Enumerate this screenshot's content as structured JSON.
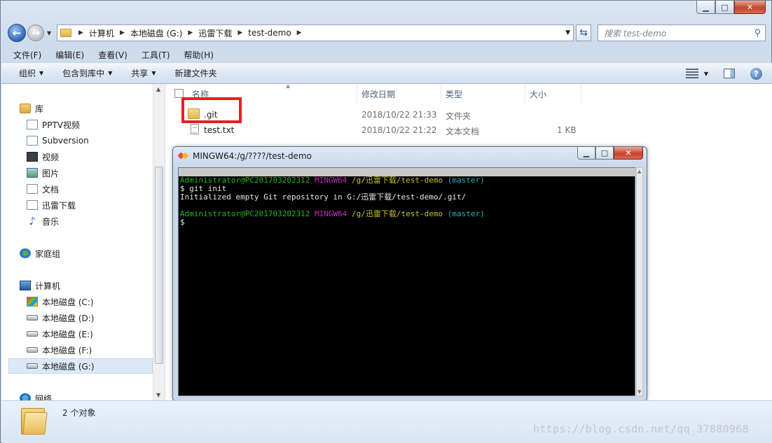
{
  "window": {
    "caption": {
      "minimize": "▁",
      "maximize": "□",
      "close": "✕"
    }
  },
  "address": {
    "breadcrumbs": [
      "计算机",
      "本地磁盘 (G:)",
      "迅雷下载",
      "test-demo"
    ],
    "search_placeholder": "搜索 test-demo"
  },
  "menubar": [
    "文件(F)",
    "编辑(E)",
    "查看(V)",
    "工具(T)",
    "帮助(H)"
  ],
  "commands": [
    "组织",
    "包含到库中",
    "共享",
    "新建文件夹"
  ],
  "navpane": {
    "libraries": "库",
    "library_items": [
      "PPTV视频",
      "Subversion",
      "视频",
      "图片",
      "文档",
      "迅雷下载",
      "音乐"
    ],
    "homegroup": "家庭组",
    "computer": "计算机",
    "drives": [
      "本地磁盘 (C:)",
      "本地磁盘 (D:)",
      "本地磁盘 (E:)",
      "本地磁盘 (F:)",
      "本地磁盘 (G:)"
    ],
    "selected_drive": "本地磁盘 (G:)",
    "network": "网络"
  },
  "columns": [
    "名称",
    "修改日期",
    "类型",
    "大小"
  ],
  "files": [
    {
      "name": ".git",
      "date": "2018/10/22 21:33",
      "type": "文件夹",
      "size": "",
      "icon": "folder-icon"
    },
    {
      "name": "test.txt",
      "date": "2018/10/22 21:22",
      "type": "文本文档",
      "size": "1 KB",
      "icon": "text-file-icon"
    }
  ],
  "status": {
    "count": "2 个对象"
  },
  "terminal": {
    "title": "MINGW64:/g/????/test-demo",
    "lines": [
      {
        "user": "Administrator@PC201703202312",
        "shell": "MINGW64",
        "path": "/g/迅雷下载/test-demo",
        "branch": "(master)"
      },
      {
        "text": "$ git init"
      },
      {
        "text": "Initialized empty Git repository in G:/迅雷下载/test-demo/.git/"
      },
      {
        "text": ""
      },
      {
        "user": "Administrator@PC201703202312",
        "shell": "MINGW64",
        "path": "/g/迅雷下载/test-demo",
        "branch": "(master)"
      },
      {
        "text": "$"
      }
    ]
  },
  "watermark": "https://blog.csdn.net/qq_37880968",
  "colors": {
    "highlight": "#ee1c24",
    "prompt_user": "#22b822",
    "prompt_shell": "#c02cc0",
    "prompt_path": "#c8c028",
    "prompt_branch": "#25b7bd"
  }
}
